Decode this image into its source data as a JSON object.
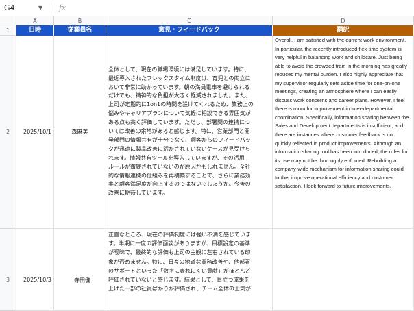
{
  "formula_bar": {
    "cell_ref": "G4",
    "fx_label": "fx",
    "content": ""
  },
  "columns": [
    "A",
    "B",
    "C",
    "D"
  ],
  "header": {
    "row_number": "1",
    "cells": [
      "日時",
      "従業員名",
      "意見・フィードバック",
      "翻訳"
    ]
  },
  "rows": [
    {
      "row_number": "2",
      "date": "2025/10/1",
      "employee": "森麻美",
      "feedback": "全体として、現在の職場環境には満足しています。特に、\n最近導入されたフレックスタイム制度は、育児との両立に\nおいて非常に助かっています。朝の満員電車を避けられる\nだけでも、精神的な負担が大きく軽減されました。また、\n上司が定期的に1on1の時間を設けてくれるため、業務上の\n悩みやキャリアプランについて気軽に相談できる雰囲気が\nある点も高く評価しています。ただし、部署間の連携につ\nいては改善の余地があると感じます。特に、営業部門と開\n発部門の情報共有が十分でなく、顧客からのフィードバッ\nクが迅速に製品改善に活かされていないケースが見受けら\nれます。情報共有ツールを導入していますが、その活用\nルールが徹底されていないのが原因かもしれません。全社\n的な情報連携の仕組みを再構築することで、さらに業務効\n率と顧客満足度が向上するのではないでしょうか。今後の\n改善に期待しています。",
      "translation": "Overall, I am satisfied with the current work environment. In particular, the recently introduced flex-time system is very helpful in balancing work and childcare. Just being able to avoid the crowded train in the morning has greatly reduced my mental burden. I also highly appreciate that my supervisor regularly sets aside time for one-on-one meetings, creating an atmosphere where I can easily discuss work concerns and career plans. However, I feel there is room for improvement in inter-departmental coordination. Specifically, information sharing between the Sales and Development departments is insufficient, and there are instances where customer feedback is not quickly reflected in product improvements. Although an information sharing tool has been introduced, the rules for its use may not be thoroughly enforced. Rebuilding a company-wide mechanism for information sharing could further improve operational efficiency and customer satisfaction. I look forward to future improvements."
    },
    {
      "row_number": "3",
      "date": "2025/10/3",
      "employee": "寺田健",
      "feedback": "正直なところ、現在の評価制度には強い不満を感じていま\nす。半期に一度の評価面談がありますが、目標設定の基準\nが曖昧で、最終的な評価も上司の主観に左右されている印\n象が否めません。特に、日々の地道な業務改善や、他部署\nのサポートといった「数字に表れにくい貢献」がほとんど\n評価されていないと感じます。結果として、目立つ成果を\n上げた一部の社員ばかりが評価され、チーム全体の士気が",
      "translation": ""
    }
  ]
}
